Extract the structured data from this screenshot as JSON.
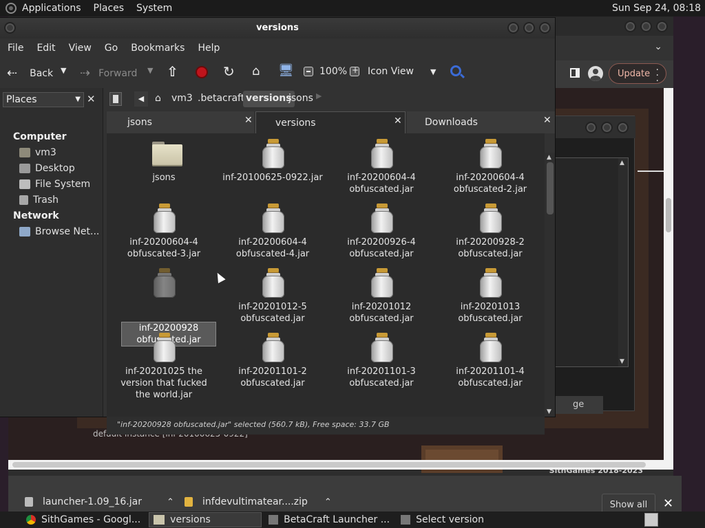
{
  "top_panel": {
    "menus": [
      "Applications",
      "Places",
      "System"
    ],
    "clock": "Sun Sep 24, 08:18"
  },
  "browser": {
    "update_label": "Update",
    "launcher_button_fragment": "ge",
    "default_instance": "default instance [inf-20100625-0922]",
    "credit": "SithGames 2018-2023",
    "downloads": [
      {
        "name": "launcher-1.09_16.jar"
      },
      {
        "name": "infdevultimatear....zip"
      }
    ],
    "show_all": "Show all"
  },
  "file_manager": {
    "title": "versions",
    "menu": [
      "File",
      "Edit",
      "View",
      "Go",
      "Bookmarks",
      "Help"
    ],
    "toolbar": {
      "back": "Back",
      "forward": "Forward",
      "zoom": "100%",
      "view_mode": "Icon View"
    },
    "sidebar": {
      "selector": "Places",
      "computer_heading": "Computer",
      "computer_items": [
        "vm3",
        "Desktop",
        "File System",
        "Trash"
      ],
      "network_heading": "Network",
      "network_items": [
        "Browse Net..."
      ]
    },
    "path": [
      "vm3",
      ".betacraft",
      "versions",
      "jsons"
    ],
    "active_path": "versions",
    "tabs": [
      {
        "label": "jsons",
        "active": false
      },
      {
        "label": "versions",
        "active": true
      },
      {
        "label": "Downloads",
        "active": false
      }
    ],
    "files": [
      {
        "type": "folder",
        "line1": "jsons",
        "line2": ""
      },
      {
        "type": "jar",
        "line1": "inf-20100625-0922.jar",
        "line2": ""
      },
      {
        "type": "jar",
        "line1": "inf-20200604-4",
        "line2": "obfuscated.jar"
      },
      {
        "type": "jar",
        "line1": "inf-20200604-4",
        "line2": "obfuscated-2.jar"
      },
      {
        "type": "jar",
        "line1": "inf-20200604-4",
        "line2": "obfuscated-3.jar"
      },
      {
        "type": "jar",
        "line1": "inf-20200604-4",
        "line2": "obfuscated-4.jar"
      },
      {
        "type": "jar",
        "line1": "inf-20200926-4",
        "line2": "obfuscated.jar"
      },
      {
        "type": "jar",
        "line1": "inf-20200928-2",
        "line2": "obfuscated.jar"
      },
      {
        "type": "jar",
        "line1": "inf-20200928",
        "line2": "obfuscated.jar",
        "selected": true
      },
      {
        "type": "jar",
        "line1": "inf-20201012-5",
        "line2": "obfuscated.jar"
      },
      {
        "type": "jar",
        "line1": "inf-20201012",
        "line2": "obfuscated.jar"
      },
      {
        "type": "jar",
        "line1": "inf-20201013",
        "line2": "obfuscated.jar"
      },
      {
        "type": "jar",
        "line1": "inf-20201025 the",
        "line2": "version that fucked",
        "line3": "the world.jar"
      },
      {
        "type": "jar",
        "line1": "inf-20201101-2",
        "line2": "obfuscated.jar"
      },
      {
        "type": "jar",
        "line1": "inf-20201101-3",
        "line2": "obfuscated.jar"
      },
      {
        "type": "jar",
        "line1": "inf-20201101-4",
        "line2": "obfuscated.jar"
      }
    ],
    "status": "\"inf-20200928 obfuscated.jar\" selected (560.7 kB), Free space: 33.7 GB"
  },
  "taskbar": [
    {
      "label": "SithGames - Googl...",
      "icon": "chrome-icon",
      "active": false
    },
    {
      "label": "versions",
      "icon": "folder-icon",
      "active": true
    },
    {
      "label": "BetaCraft Launcher ...",
      "icon": "java-icon",
      "active": false
    },
    {
      "label": "Select version",
      "icon": "java-icon",
      "active": false
    }
  ]
}
